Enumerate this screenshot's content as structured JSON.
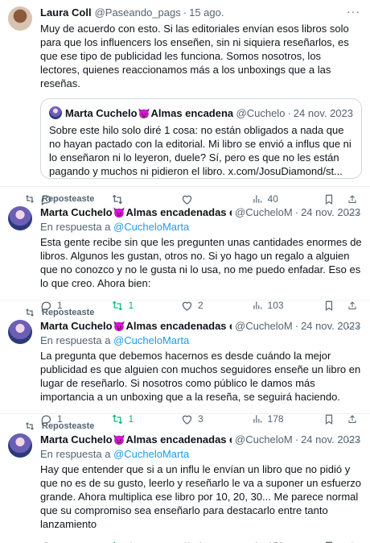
{
  "tweets": [
    {
      "name": "Laura Coll",
      "handle": "@Paseando_pags",
      "date": "15 ago.",
      "text": "Muy de acuerdo con esto. Si las editoriales envían esos libros solo para que los influencers los enseñen, sin ni siquiera reseñarlos, es que ese tipo de publicidad les funciona. Somos nosotros, los lectores, quienes reaccionamos más a los unboxings que a las reseñas.",
      "quote": {
        "name": "Marta Cuchelo",
        "name_suffix": "Almas encadenadas en",
        "handle": "@Cuchelo",
        "date": "24 nov. 2023",
        "text": "Sobre este hilo solo diré 1 cosa: no están obligados a nada que no hayan pactado con la editorial. Mi libro se envió a influs que ni lo enseñaron ni lo leyeron, duele? Sí, pero es que no les están pagando y muchos ni pidieron el libro. x.com/JosuDiamond/st..."
      },
      "replies": "",
      "reposts": "",
      "likes": "",
      "views": "40"
    },
    {
      "repost_label": "Reposteaste",
      "name": "Marta Cuchelo",
      "name_suffix": "Almas encadenadas en fi",
      "handle": "@CucheloM",
      "date": "24 nov. 2023",
      "reply_prefix": "En respuesta a",
      "reply_to": "@CucheloMarta",
      "text": "Esta gente recibe sin que les pregunten unas cantidades enormes de libros. Algunos les gustan, otros no. Si yo hago un regalo a alguien que no conozco y no le gusta ni lo usa, no me puedo enfadar. Eso es lo que creo. Ahora bien:",
      "replies": "1",
      "reposts": "1",
      "likes": "2",
      "views": "103"
    },
    {
      "repost_label": "Reposteaste",
      "name": "Marta Cuchelo",
      "name_suffix": "Almas encadenadas en fi",
      "handle": "@CucheloM",
      "date": "24 nov. 2023",
      "reply_prefix": "En respuesta a",
      "reply_to": "@CucheloMarta",
      "text": "La pregunta que debemos hacernos es desde cuándo la mejor publicidad es que alguien con muchos seguidores enseñe un libro en lugar de reseñarlo. Si nosotros como público le damos más importancia a un unboxing que a la reseña, se seguirá haciendo.",
      "replies": "1",
      "reposts": "1",
      "likes": "3",
      "views": "178"
    },
    {
      "repost_label": "Reposteaste",
      "name": "Marta Cuchelo",
      "name_suffix": "Almas encadenadas en fi",
      "handle": "@CucheloM",
      "date": "24 nov. 2023",
      "reply_prefix": "En respuesta a",
      "reply_to": "@CucheloMarta",
      "text": "Hay que entender que si a un influ le envían un libro que no pidió y que no es de su gusto, leerlo y reseñarlo le va a suponer un esfuerzo grande. Ahora multiplica ese libro por 10, 20, 30... Me parece normal que su compromiso sea enseñarlo para destacarlo entre tanto lanzamiento",
      "replies": "",
      "reposts": "1",
      "likes": "1",
      "views": "158"
    }
  ],
  "icons": {
    "more": "more-icon",
    "reply": "reply-icon",
    "repost": "repost-icon",
    "like": "like-icon",
    "views": "views-icon",
    "bookmark": "bookmark-icon",
    "share": "share-icon",
    "name_emoji": "devil-emoji-icon"
  },
  "colors": {
    "link": "#1d9bf0",
    "repost_active": "#00ba7c",
    "secondary_text": "#536471"
  }
}
